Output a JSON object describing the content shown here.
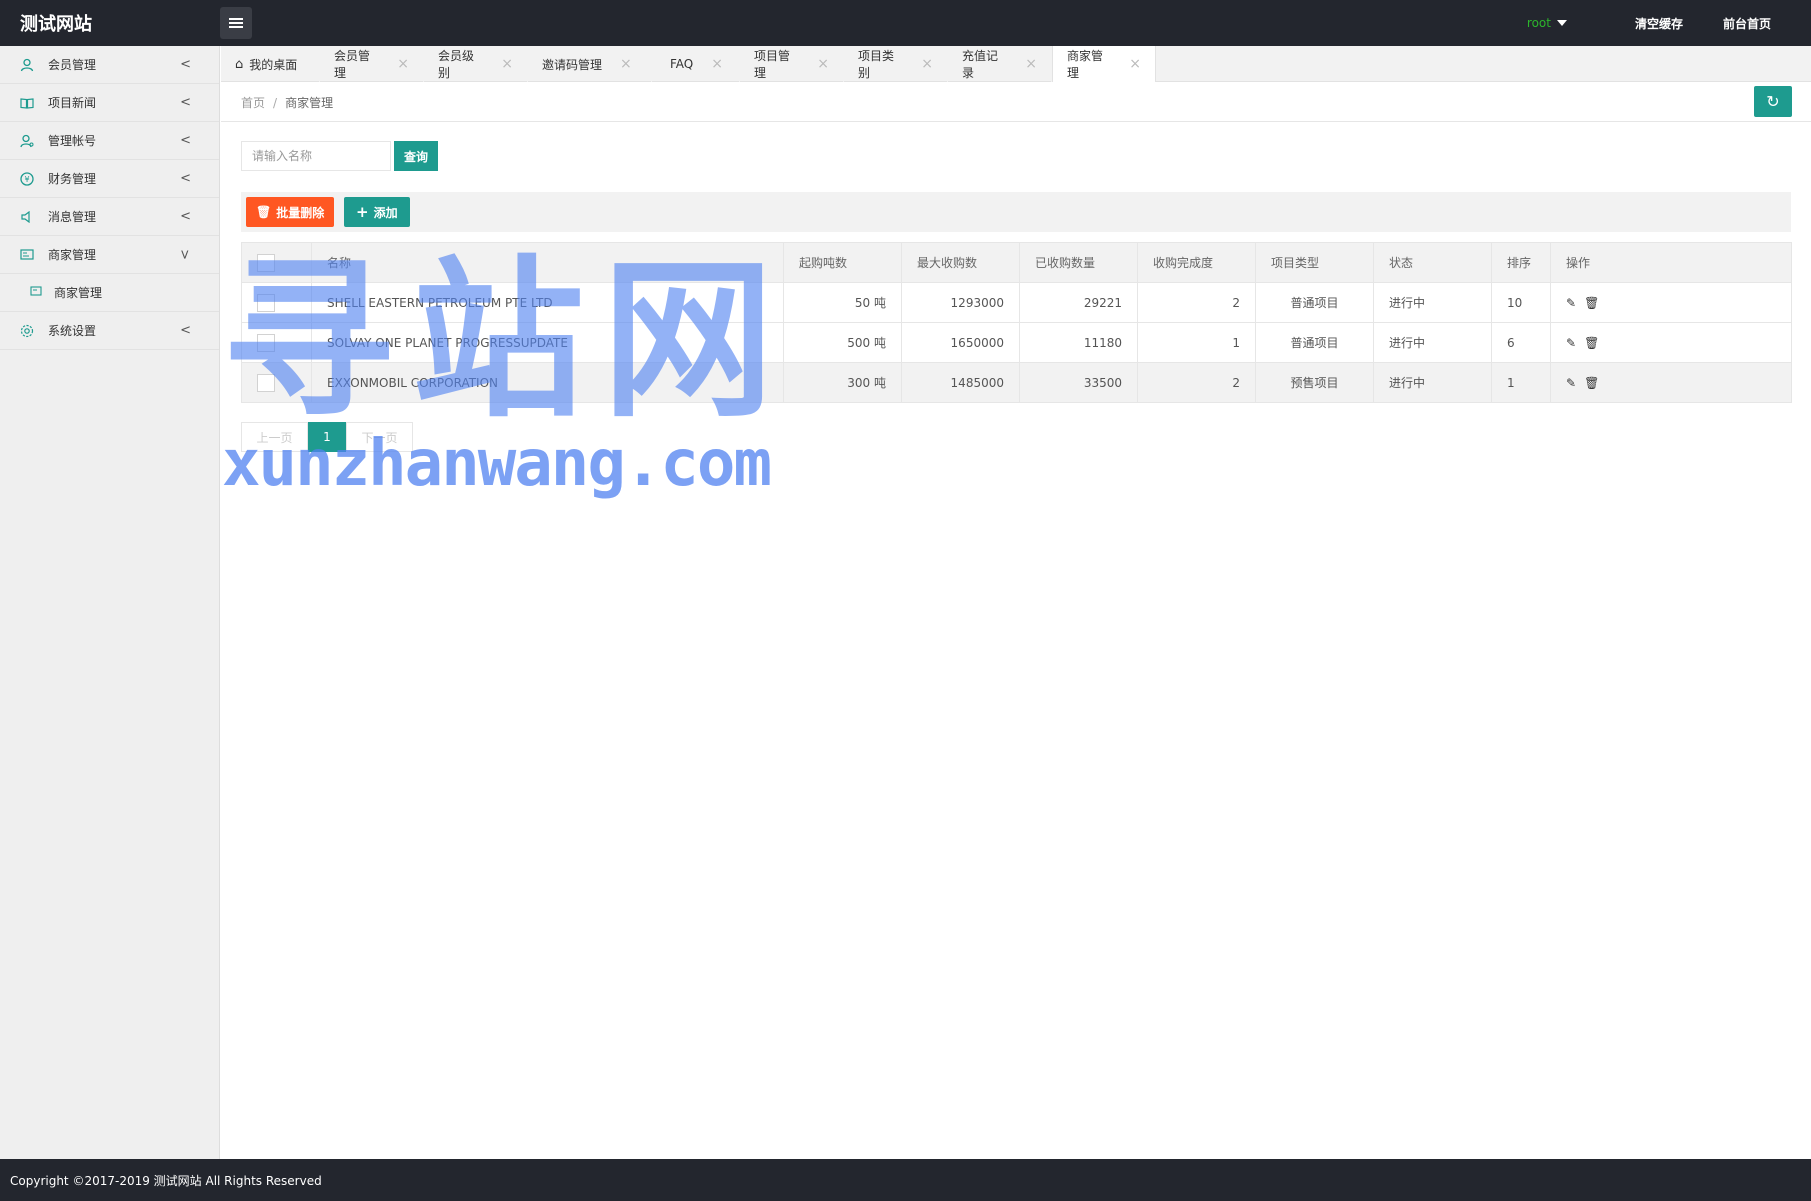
{
  "header": {
    "logo": "测试网站",
    "user": "root",
    "links": [
      "清空缓存",
      "前台首页"
    ]
  },
  "sidebar": {
    "items": [
      {
        "label": "会员管理",
        "icon": "user-icon"
      },
      {
        "label": "项目新闻",
        "icon": "book-icon"
      },
      {
        "label": "管理帐号",
        "icon": "admin-icon"
      },
      {
        "label": "财务管理",
        "icon": "money-icon"
      },
      {
        "label": "消息管理",
        "icon": "speaker-icon"
      },
      {
        "label": "商家管理",
        "icon": "card-icon",
        "expanded": true,
        "children": [
          {
            "label": "商家管理",
            "icon": "card-icon"
          }
        ]
      },
      {
        "label": "系统设置",
        "icon": "gear-icon"
      }
    ]
  },
  "tabs": [
    {
      "label": "我的桌面",
      "closable": false
    },
    {
      "label": "会员管理",
      "closable": true
    },
    {
      "label": "会员级别",
      "closable": true
    },
    {
      "label": "邀请码管理",
      "closable": true
    },
    {
      "label": "FAQ",
      "closable": true
    },
    {
      "label": "项目管理",
      "closable": true
    },
    {
      "label": "项目类别",
      "closable": true
    },
    {
      "label": "充值记录",
      "closable": true
    },
    {
      "label": "商家管理",
      "closable": true,
      "active": true
    }
  ],
  "breadcrumb": {
    "home": "首页",
    "separator": "/",
    "current": "商家管理"
  },
  "search": {
    "placeholder": "请输入名称",
    "button": "查询"
  },
  "toolbar": {
    "batch_delete": "批量删除",
    "add": "添加"
  },
  "table": {
    "columns": [
      "名称",
      "起购吨数",
      "最大收购数",
      "已收购数量",
      "收购完成度",
      "项目类型",
      "状态",
      "排序",
      "操作"
    ],
    "rows": [
      {
        "name": "SHELL EASTERN PETROLEUM PTE LTD",
        "min": "50 吨",
        "max": "1293000",
        "bought": "29221",
        "progress": "2",
        "type": "普通项目",
        "type_kind": "normal",
        "status": "进行中",
        "sort": "10"
      },
      {
        "name": "SOLVAY ONE PLANET PROGRESSUPDATE",
        "min": "500 吨",
        "max": "1650000",
        "bought": "11180",
        "progress": "1",
        "type": "普通项目",
        "type_kind": "normal",
        "status": "进行中",
        "sort": "6"
      },
      {
        "name": "EXXONMOBIL CORPORATION",
        "min": "300 吨",
        "max": "1485000",
        "bought": "33500",
        "progress": "2",
        "type": "预售项目",
        "type_kind": "pre",
        "status": "进行中",
        "sort": "1"
      }
    ]
  },
  "pager": {
    "prev": "上一页",
    "current": "1",
    "next": "下一页"
  },
  "watermark": {
    "big": "寻站网",
    "small": "xunzhanwang.com"
  },
  "footer": {
    "text": "Copyright ©2017-2019 测试网站 All Rights Reserved"
  },
  "colors": {
    "header": "#23262e",
    "accent": "#1e9b8f",
    "danger": "#ff5722",
    "normal_type": "#2e8b2e",
    "pre_type": "#e02020"
  }
}
